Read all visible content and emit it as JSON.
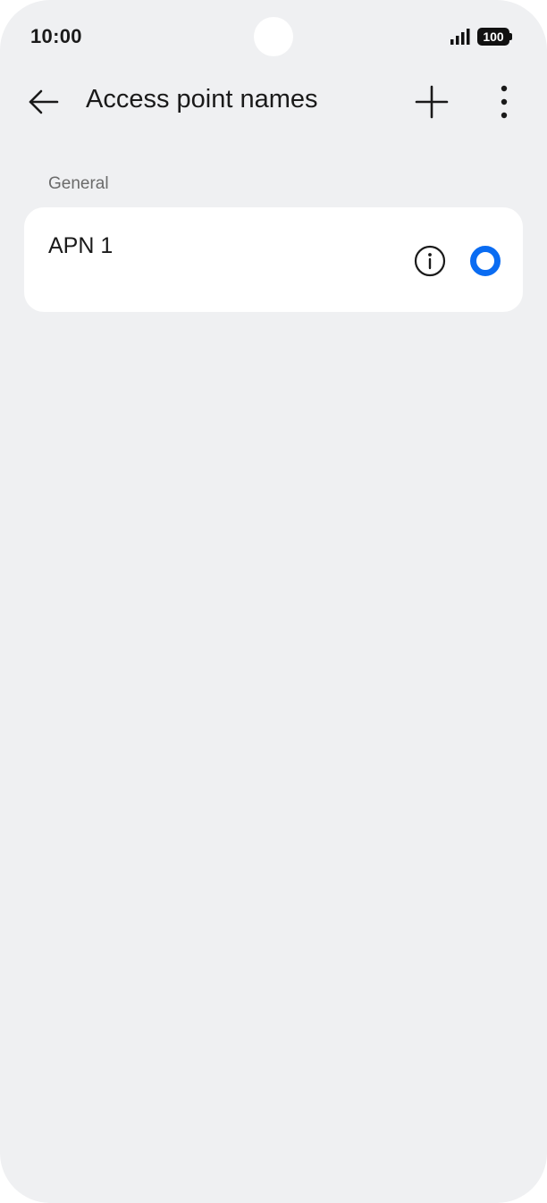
{
  "status_bar": {
    "time": "10:00",
    "battery": "100"
  },
  "app_bar": {
    "title": "Access point names"
  },
  "section": {
    "header": "General"
  },
  "apn_list": {
    "items": [
      {
        "name": "APN 1",
        "selected": true
      }
    ]
  },
  "icons": {
    "back": "arrow-left-icon",
    "add": "plus-icon",
    "more": "more-vertical-icon",
    "info": "info-icon",
    "radio": "radio-selected-icon",
    "signal": "signal-icon",
    "battery": "battery-icon"
  },
  "colors": {
    "background": "#eff0f2",
    "card": "#ffffff",
    "accent": "#0a6cf2",
    "text": "#1a1a1a",
    "muted": "#6b6b6b"
  }
}
